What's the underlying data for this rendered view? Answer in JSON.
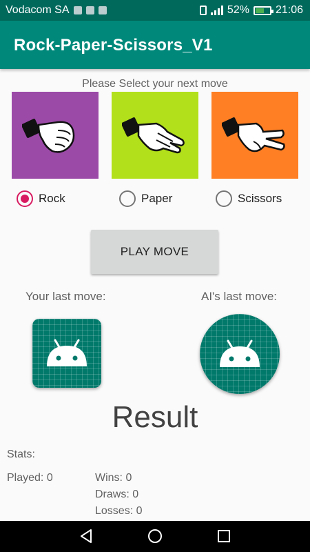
{
  "status_bar": {
    "carrier": "Vodacom SA",
    "battery": "52%",
    "time": "21:06"
  },
  "app": {
    "title": "Rock-Paper-Scissors_V1"
  },
  "prompt": "Please Select your next move",
  "moves": [
    {
      "label": "Rock",
      "color": "#9c4aa8",
      "selected": true
    },
    {
      "label": "Paper",
      "color": "#b2e01a",
      "selected": false
    },
    {
      "label": "Scissors",
      "color": "#fe7f24",
      "selected": false
    }
  ],
  "play_button": "PLAY MOVE",
  "your_last_move_label": "Your last move:",
  "ai_last_move_label": "AI's last move:",
  "result": "Result",
  "stats": {
    "title": "Stats:",
    "played": "Played: 0",
    "wins": "Wins: 0",
    "draws": "Draws: 0",
    "losses": "Losses: 0"
  },
  "colors": {
    "primary": "#00897b",
    "primary_dark": "#00695c",
    "accent": "#d81b60"
  },
  "icons": [
    "bluetooth-icon",
    "image-icon",
    "shield-icon",
    "vibrate-icon",
    "signal-icon",
    "battery-icon",
    "back-icon",
    "home-icon",
    "recents-icon",
    "android-icon"
  ]
}
